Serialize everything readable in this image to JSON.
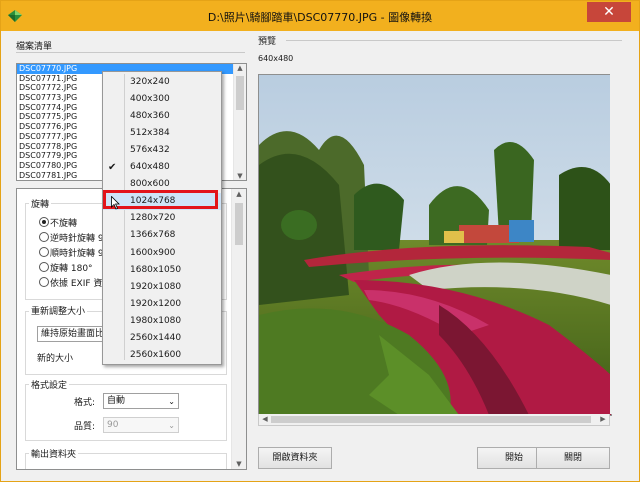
{
  "window": {
    "title": "D:\\照片\\騎腳踏車\\DSC07770.JPG - 圖像轉換",
    "close_glyph": "✕"
  },
  "file_list": {
    "label": "檔案清單",
    "items": [
      "DSC07770.JPG",
      "DSC07771.JPG",
      "DSC07772.JPG",
      "DSC07773.JPG",
      "DSC07774.JPG",
      "DSC07775.JPG",
      "DSC07776.JPG",
      "DSC07777.JPG",
      "DSC07778.JPG",
      "DSC07779.JPG",
      "DSC07780.JPG",
      "DSC07781.JPG"
    ],
    "selected_index": 0
  },
  "rotate": {
    "title": "旋轉",
    "options": [
      "不旋轉",
      "逆時針旋轉 9",
      "順時針旋轉 9",
      "旋轉 180°",
      "依據 EXIF 資"
    ],
    "selected_index": 0
  },
  "resize": {
    "title": "重新調整大小",
    "mode_value": "維持原始畫面比",
    "new_size_label": "新的大小"
  },
  "format": {
    "title": "格式設定",
    "format_label": "格式:",
    "format_value": "自動",
    "quality_label": "品質:",
    "quality_value": "90"
  },
  "output": {
    "title": "輸出資料夾"
  },
  "preview": {
    "label": "預覽",
    "size_text": "640x480"
  },
  "size_dropdown": {
    "options": [
      "320x240",
      "400x300",
      "480x360",
      "512x384",
      "576x432",
      "640x480",
      "800x600",
      "1024x768",
      "1280x720",
      "1366x768",
      "1600x900",
      "1680x1050",
      "1920x1080",
      "1920x1200",
      "1980x1080",
      "2560x1440",
      "2560x1600"
    ],
    "checked": "640x480",
    "highlighted": "1024x768",
    "check_glyph": "✔"
  },
  "buttons": {
    "open_folder": "開啟資料夾",
    "start": "開始",
    "close": "關閉"
  },
  "icons": {
    "app": "diamond-app-icon",
    "cursor": "mouse-pointer-icon"
  },
  "colors": {
    "titlebar": "#f2b01e",
    "selection": "#3399ff",
    "highlight_box": "#e2131a"
  }
}
